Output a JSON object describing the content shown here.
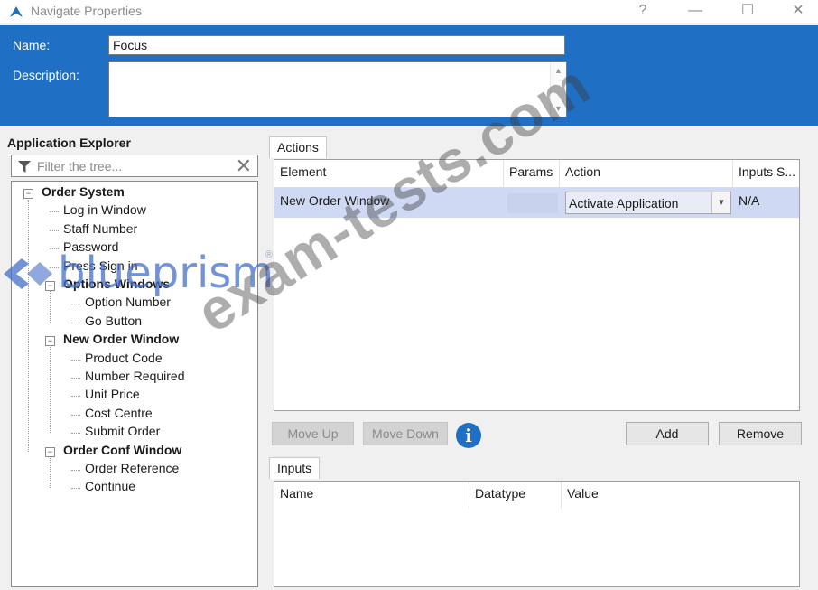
{
  "window": {
    "title": "Navigate Properties",
    "help": "?",
    "minimize": "—",
    "maximize": "☐",
    "close": "✕"
  },
  "header": {
    "name_label": "Name:",
    "name_value": "Focus",
    "description_label": "Description:",
    "description_value": ""
  },
  "explorer": {
    "title": "Application Explorer",
    "filter_placeholder": "Filter the tree...",
    "tree": [
      {
        "label": "Order System",
        "bold": true,
        "level": 0
      },
      {
        "label": "Log in Window",
        "level": 1
      },
      {
        "label": "Staff Number",
        "level": 1
      },
      {
        "label": "Password",
        "level": 1
      },
      {
        "label": "Press Sign in",
        "level": 1
      },
      {
        "label": "Options Windows",
        "bold": true,
        "level": 1
      },
      {
        "label": "Option Number",
        "level": 2
      },
      {
        "label": "Go Button",
        "level": 2
      },
      {
        "label": "New Order Window",
        "bold": true,
        "level": 1
      },
      {
        "label": "Product Code",
        "level": 2
      },
      {
        "label": "Number Required",
        "level": 2
      },
      {
        "label": "Unit Price",
        "level": 2
      },
      {
        "label": "Cost Centre",
        "level": 2
      },
      {
        "label": "Submit Order",
        "level": 2
      },
      {
        "label": "Order Conf Window",
        "bold": true,
        "level": 1
      },
      {
        "label": "Order Reference",
        "level": 2
      },
      {
        "label": "Continue",
        "level": 2
      }
    ]
  },
  "actions": {
    "tab": "Actions",
    "columns": [
      "Element",
      "Params",
      "Action",
      "Inputs S..."
    ],
    "rows": [
      {
        "element": "New Order Window",
        "params": "",
        "action": "Activate Application",
        "inputs": "N/A"
      }
    ]
  },
  "buttons": {
    "move_up": "Move Up",
    "move_down": "Move Down",
    "info": "i",
    "add": "Add",
    "remove": "Remove"
  },
  "inputs": {
    "tab": "Inputs",
    "columns": [
      "Name",
      "Datatype",
      "Value"
    ]
  },
  "watermark": {
    "text": "exam-tests.com",
    "logo": "blueprism",
    "reg": "®"
  },
  "colors": {
    "header_blue": "#1f6fc4",
    "selected_row": "#cfd9f3"
  }
}
